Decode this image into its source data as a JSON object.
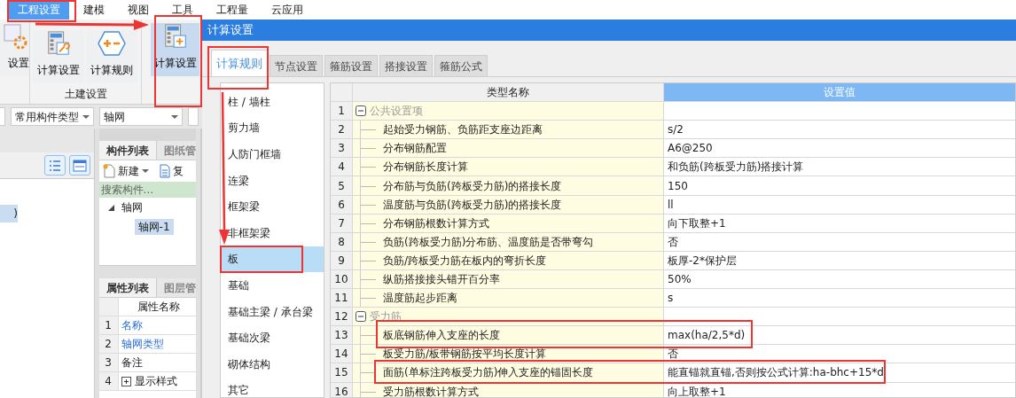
{
  "menu": [
    {
      "label": "工程设置",
      "selected": true
    },
    {
      "label": "建模",
      "selected": false
    },
    {
      "label": "视图",
      "selected": false
    },
    {
      "label": "工具",
      "selected": false
    },
    {
      "label": "工程量",
      "selected": false
    },
    {
      "label": "云应用",
      "selected": false
    }
  ],
  "ribbon": {
    "groups": [
      {
        "buttons": [
          {
            "label": "设置",
            "kind": "gear",
            "selected": false
          }
        ]
      },
      {
        "label": "土建设置",
        "buttons": [
          {
            "label": "计算设置",
            "kind": "calc",
            "selected": false
          },
          {
            "label": "计算规则",
            "kind": "rule",
            "selected": false
          }
        ]
      },
      {
        "buttons": [
          {
            "label": "计算设置",
            "kind": "calc-plus",
            "selected": true
          }
        ]
      }
    ]
  },
  "filters": [
    {
      "value": "常用构件类型"
    },
    {
      "value": "轴网"
    }
  ],
  "left_panel": {
    "items": [
      {
        "label": ")",
        "selected": true
      }
    ]
  },
  "component_panel": {
    "tabs": [
      {
        "label": "构件列表",
        "selected": true
      },
      {
        "label": "图纸管",
        "selected": false
      }
    ],
    "toolbar": [
      {
        "label": "新建",
        "kind": "new"
      },
      {
        "label": "复",
        "kind": "copy"
      }
    ],
    "search": {
      "placeholder": "搜索构件..."
    },
    "tree": [
      {
        "label": "轴网",
        "expanded": true,
        "selected": false,
        "children": [
          {
            "label": "轴网-1",
            "selected": true
          }
        ]
      }
    ]
  },
  "property_panel": {
    "tabs": [
      {
        "label": "属性列表",
        "selected": true
      },
      {
        "label": "图层管",
        "selected": false
      }
    ],
    "columns": [
      "属性名称"
    ],
    "rows": [
      {
        "num": "1",
        "name": "名称",
        "link": true
      },
      {
        "num": "2",
        "name": "轴网类型",
        "link": true
      },
      {
        "num": "3",
        "name": "备注",
        "link": false
      },
      {
        "num": "4",
        "name": "显示样式",
        "link": false,
        "expanded": false
      }
    ]
  },
  "dialog": {
    "title": "计算设置",
    "tabs": [
      {
        "label": "计算规则",
        "selected": true
      },
      {
        "label": "节点设置",
        "selected": false
      },
      {
        "label": "箍筋设置",
        "selected": false
      },
      {
        "label": "搭接设置",
        "selected": false
      },
      {
        "label": "箍筋公式",
        "selected": false
      }
    ],
    "categories": [
      {
        "label": "柱 / 墙柱",
        "selected": false
      },
      {
        "label": "剪力墙",
        "selected": false
      },
      {
        "label": "人防门框墙",
        "selected": false
      },
      {
        "label": "连梁",
        "selected": false
      },
      {
        "label": "框架梁",
        "selected": false
      },
      {
        "label": "非框架梁",
        "selected": false
      },
      {
        "label": "板",
        "selected": true
      },
      {
        "label": "基础",
        "selected": false
      },
      {
        "label": "基础主梁 / 承台梁",
        "selected": false
      },
      {
        "label": "基础次梁",
        "selected": false
      },
      {
        "label": "砌体结构",
        "selected": false
      },
      {
        "label": "其它",
        "selected": false
      }
    ],
    "table": {
      "columns": [
        "类型名称",
        "设置值"
      ],
      "rows": [
        {
          "num": "1",
          "name": "公共设置项",
          "expanded": true,
          "children": [
            {
              "num": "2",
              "name": "起始受力钢筋、负筋距支座边距离",
              "value": "s/2"
            },
            {
              "num": "3",
              "name": "分布钢筋配置",
              "value": "A6@250"
            },
            {
              "num": "4",
              "name": "分布钢筋长度计算",
              "value": "和负筋(跨板受力筋)搭接计算"
            },
            {
              "num": "5",
              "name": "分布筋与负筋(跨板受力筋)的搭接长度",
              "value": "150"
            },
            {
              "num": "6",
              "name": "温度筋与负筋(跨板受力筋)的搭接长度",
              "value": "ll"
            },
            {
              "num": "7",
              "name": "分布钢筋根数计算方式",
              "value": "向下取整+1"
            },
            {
              "num": "8",
              "name": "负筋(跨板受力筋)分布筋、温度筋是否带弯勾",
              "value": "否"
            },
            {
              "num": "9",
              "name": "负筋/跨板受力筋在板内的弯折长度",
              "value": "板厚-2*保护层"
            },
            {
              "num": "10",
              "name": "纵筋搭接接头错开百分率",
              "value": "50%"
            },
            {
              "num": "11",
              "name": "温度筋起步距离",
              "value": "s"
            }
          ]
        },
        {
          "num": "12",
          "name": "受力筋",
          "expanded": true,
          "children": [
            {
              "num": "13",
              "name": "板底钢筋伸入支座的长度",
              "value": "max(ha/2,5*d)"
            },
            {
              "num": "14",
              "name": "板受力筋/板带钢筋按平均长度计算",
              "value": "否"
            },
            {
              "num": "15",
              "name": "面筋(单标注跨板受力筋)伸入支座的锚固长度",
              "value": "能直锚就直锚,否则按公式计算:ha-bhc+15*d"
            },
            {
              "num": "16",
              "name": "受力筋根数计算方式",
              "value": "向上取整+1"
            }
          ]
        }
      ]
    }
  }
}
